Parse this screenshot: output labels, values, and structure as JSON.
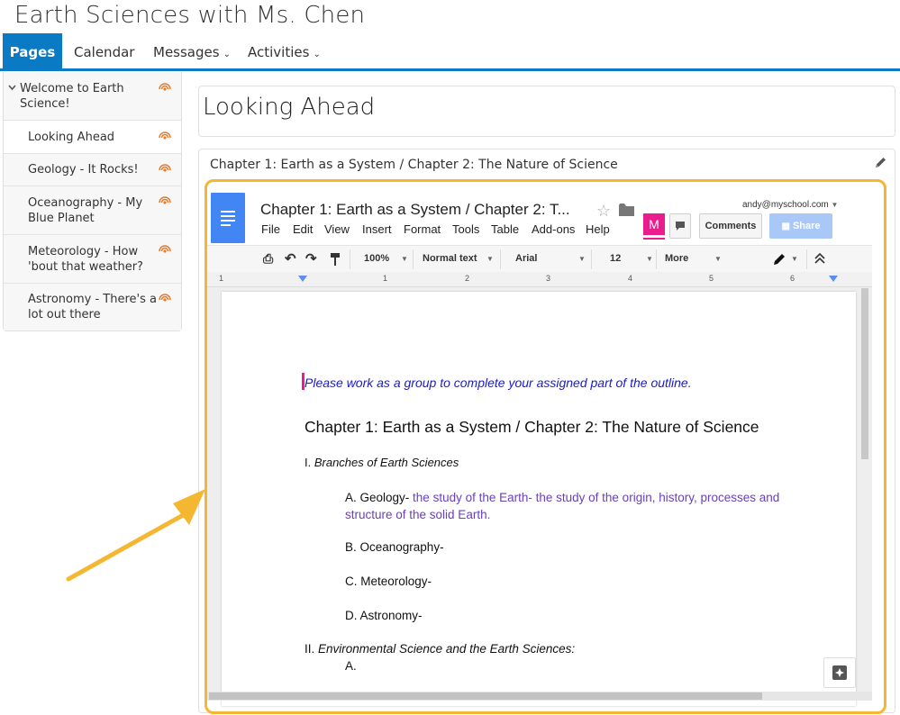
{
  "site": {
    "title": "Earth Sciences with Ms. Chen"
  },
  "nav": {
    "tabs": [
      {
        "label": "Pages"
      },
      {
        "label": "Calendar"
      },
      {
        "label": "Messages"
      },
      {
        "label": "Activities"
      }
    ],
    "dropdown_caret": "⌄"
  },
  "sidebar": {
    "items": [
      {
        "label": "Welcome to Earth Science!",
        "line1": "Welcome to Earth",
        "line2": "Science!"
      },
      {
        "label": "Looking Ahead"
      },
      {
        "label": "Geology - It Rocks!"
      },
      {
        "label": "Oceanography - My Blue Planet",
        "line1": "Oceanography - My",
        "line2": "Blue Planet"
      },
      {
        "label": "Meteorology - How 'bout that weather?",
        "line1": "Meteorology - How",
        "line2": "'bout that weather?"
      },
      {
        "label": "Astronomy - There's a lot out there",
        "line1": "Astronomy - There's a",
        "line2": "lot out there"
      }
    ],
    "expand_icon": "chevron-down-icon",
    "item_icon": "rss-icon",
    "icon_color": "#e57c2f"
  },
  "main": {
    "page_title": "Looking Ahead",
    "panel_title": "Chapter 1: Earth as a System / Chapter 2: The Nature of Science",
    "edit_icon": "pencil-icon"
  },
  "gdoc": {
    "title": "Chapter 1: Earth as a System / Chapter 2: T...",
    "account": "andy@myschool.com",
    "menu": [
      "File",
      "Edit",
      "View",
      "Insert",
      "Format",
      "Tools",
      "Table",
      "Add-ons",
      "Help"
    ],
    "comments_label": "Comments",
    "share_label": "Share",
    "avatar_letter": "M",
    "toolbar": {
      "zoom": "100%",
      "style": "Normal text",
      "font": "Arial",
      "size": "12",
      "more": "More"
    },
    "ruler_numbers": [
      "1",
      "1",
      "2",
      "3",
      "4",
      "5",
      "6"
    ],
    "content": {
      "instruction": "Please work as a group to complete your assigned part of the outline.",
      "heading": "Chapter 1: Earth as a System / Chapter 2: The Nature of Science",
      "section1_prefix": "I. ",
      "section1_title": "Branches of Earth Sciences",
      "item_a_label": "A. Geology-",
      "item_a_text_line1": " the study of the Earth- the study of the origin, history, processes and",
      "item_a_text_line2": "structure of the solid Earth.",
      "item_b": "B. Oceanography-",
      "item_c": "C. Meteorology-",
      "item_d": "D. Astronomy-",
      "section2_prefix": "II. ",
      "section2_title": "Environmental Science and the Earth Sciences:",
      "item_2a": "A."
    }
  },
  "colors": {
    "accent": "#0a7ac4",
    "highlight_border": "#f5b731",
    "arrow": "#f5b731",
    "instruction_text": "#1a1acc",
    "answer_text": "#6a3fc0",
    "docs_blue": "#4285f4",
    "avatar_pink": "#e91e8c"
  }
}
